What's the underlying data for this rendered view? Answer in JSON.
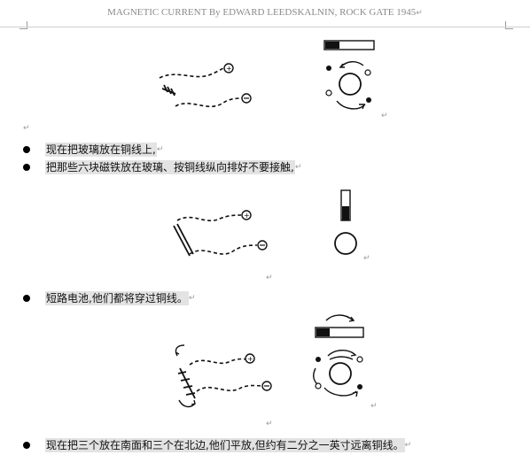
{
  "header": {
    "title": "MAGNETIC CURRENT By EDWARD LEEDSKALNIN, ROCK GATE 1945",
    "paragraph_mark": "↵"
  },
  "paragraphs": {
    "p1": "现在把玻璃放在铜线上,",
    "p2": "把那些六块磁铁放在玻璃、按铜线纵向排好不要接触,",
    "p3": "短路电池,他们都将穿过铜线。",
    "p4": "现在把三个放在南面和三个在北边,他们平放,但约有二分之一英寸远离铜线。"
  },
  "mark": "↵"
}
